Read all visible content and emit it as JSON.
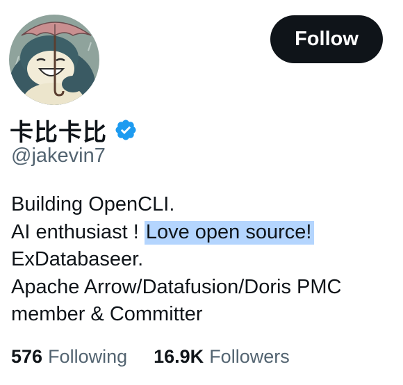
{
  "profile": {
    "display_name": "卡比卡比",
    "handle": "@jakevin7",
    "verified_icon": "verified-badge-icon",
    "avatar_icon": "snorlax-umbrella-avatar"
  },
  "follow_button": {
    "label": "Follow"
  },
  "bio": {
    "line1": "Building OpenCLI.",
    "line2_prefix": "AI enthusiast ! ",
    "line2_highlight": "Love open source!",
    "line3": "ExDatabaseer.",
    "line4": "Apache Arrow/Datafusion/Doris PMC",
    "line5": "member & Committer"
  },
  "stats": {
    "following_count": "576",
    "following_label": "Following",
    "followers_count": "16.9K",
    "followers_label": "Followers"
  },
  "colors": {
    "primary_text": "#0f1419",
    "secondary_text": "#536471",
    "verified_blue": "#1d9bf0",
    "selection_highlight": "#b4d5fe",
    "button_bg": "#0f1419"
  }
}
